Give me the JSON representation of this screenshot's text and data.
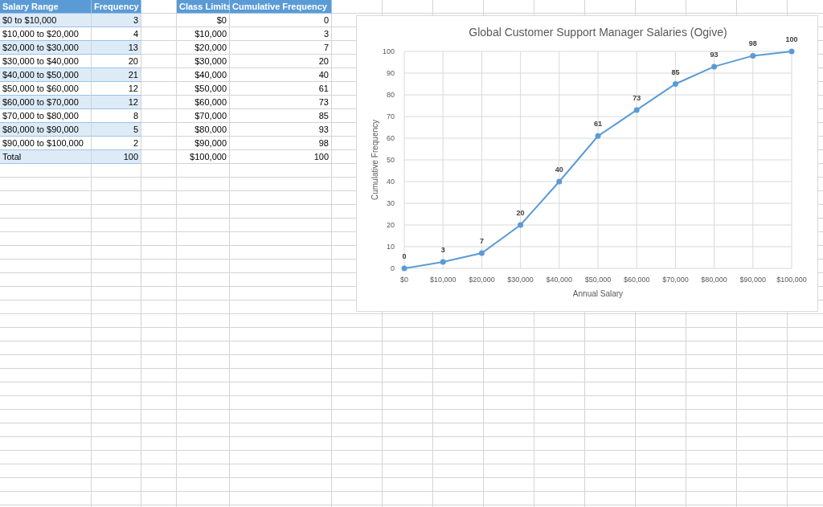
{
  "frequency_table": {
    "columns": [
      "Salary Range",
      "Frequency"
    ],
    "rows": [
      [
        "$0 to $10,000",
        "3"
      ],
      [
        "$10,000 to $20,000",
        "4"
      ],
      [
        "$20,000 to $30,000",
        "13"
      ],
      [
        "$30,000 to $40,000",
        "20"
      ],
      [
        "$40,000 to $50,000",
        "21"
      ],
      [
        "$50,000 to $60,000",
        "12"
      ],
      [
        "$60,000 to $70,000",
        "12"
      ],
      [
        "$70,000 to $80,000",
        "8"
      ],
      [
        "$80,000 to $90,000",
        "5"
      ],
      [
        "$90,000 to $100,000",
        "2"
      ]
    ],
    "total": [
      "Total",
      "100"
    ]
  },
  "cumulative_table": {
    "columns": [
      "Class Limits",
      "Cumulative Frequency"
    ],
    "rows": [
      [
        "$0",
        "0"
      ],
      [
        "$10,000",
        "3"
      ],
      [
        "$20,000",
        "7"
      ],
      [
        "$30,000",
        "20"
      ],
      [
        "$40,000",
        "40"
      ],
      [
        "$50,000",
        "61"
      ],
      [
        "$60,000",
        "73"
      ],
      [
        "$70,000",
        "85"
      ],
      [
        "$80,000",
        "93"
      ],
      [
        "$90,000",
        "98"
      ],
      [
        "$100,000",
        "100"
      ]
    ]
  },
  "chart": {
    "chart_data": {
      "type": "line",
      "title": "Global Customer Support Manager Salaries (Ogive)",
      "xlabel": "Annual Salary",
      "ylabel": "Cumulative Frequency",
      "categories": [
        "$0",
        "$10,000",
        "$20,000",
        "$30,000",
        "$40,000",
        "$50,000",
        "$60,000",
        "$70,000",
        "$80,000",
        "$90,000",
        "$100,000"
      ],
      "series": [
        {
          "color": "#5b9bd5",
          "marker": "circle",
          "values": [
            0,
            3,
            7,
            20,
            40,
            61,
            73,
            85,
            93,
            98,
            100
          ]
        }
      ],
      "grid": true,
      "ylim": [
        0,
        100
      ],
      "yticks": [
        0,
        10,
        20,
        30,
        40,
        50,
        60,
        70,
        80,
        90,
        100
      ],
      "data_labels": true
    }
  }
}
